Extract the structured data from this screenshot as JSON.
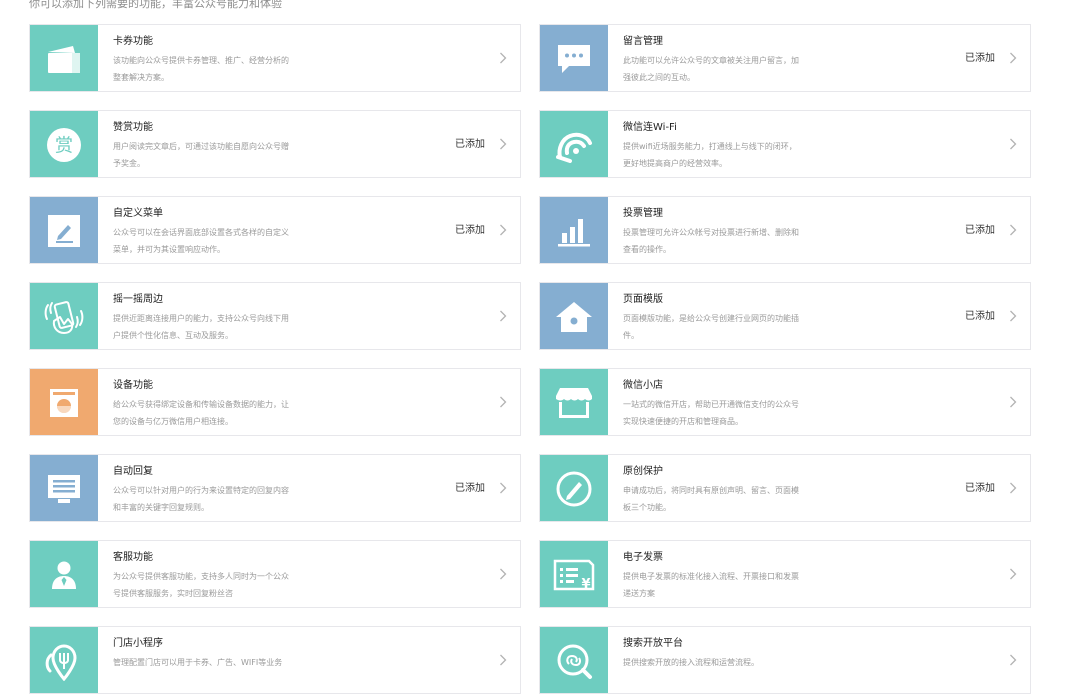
{
  "intro": "你可以添加下列需要的功能，丰富公众号能力和体验",
  "added_label": "已添加",
  "colors": {
    "teal": "#6ecdc0",
    "blue": "#85aed1",
    "orange": "#f0a96f",
    "border": "#e7e7eb"
  },
  "features": [
    {
      "title": "卡券功能",
      "desc": "该功能向公众号提供卡券管理、推广、经营分析的整套解决方案。",
      "status": "",
      "icon": "card-icon"
    },
    {
      "title": "留言管理",
      "desc": "此功能可以允许公众号的文章被关注用户留言，加强彼此之间的互动。",
      "status": "已添加",
      "icon": "message-icon"
    },
    {
      "title": "赞赏功能",
      "desc": "用户阅读完文章后，可通过该功能自愿向公众号赠予奖金。",
      "status": "已添加",
      "icon": "reward-icon"
    },
    {
      "title": "微信连Wi-Fi",
      "desc": "提供wifi近场服务能力，打通线上与线下的闭环，更好地提高商户的经营效率。",
      "status": "",
      "icon": "wifi-icon"
    },
    {
      "title": "自定义菜单",
      "desc": "公众号可以在会话界面底部设置各式各样的自定义菜单，并可为其设置响应动作。",
      "status": "已添加",
      "icon": "edit-menu-icon"
    },
    {
      "title": "投票管理",
      "desc": "投票管理可允许公众帐号对投票进行新增、删除和查看的操作。",
      "status": "已添加",
      "icon": "bar-chart-icon"
    },
    {
      "title": "摇一摇周边",
      "desc": "提供近距离连接用户的能力，支持公众号向线下用户提供个性化信息、互动及服务。",
      "status": "",
      "icon": "shake-phone-icon"
    },
    {
      "title": "页面模版",
      "desc": "页面模版功能，是给公众号创建行业网页的功能插件。",
      "status": "已添加",
      "icon": "house-icon"
    },
    {
      "title": "设备功能",
      "desc": "给公众号获得绑定设备和传输设备数据的能力，让您的设备与亿万微信用户相连接。",
      "status": "",
      "icon": "device-icon"
    },
    {
      "title": "微信小店",
      "desc": "一站式的微信开店，帮助已开通微信支付的公众号实现快速便捷的开店和管理商品。",
      "status": "",
      "icon": "store-icon"
    },
    {
      "title": "自动回复",
      "desc": "公众号可以针对用户的行为来设置特定的回复内容和丰富的关键字回复规则。",
      "status": "已添加",
      "icon": "auto-reply-icon"
    },
    {
      "title": "原创保护",
      "desc": "申请成功后，将同时具有原创声明、留言、页面模板三个功能。",
      "status": "已添加",
      "icon": "original-pen-icon"
    },
    {
      "title": "客服功能",
      "desc": "为公众号提供客服功能，支持多人同时为一个公众号提供客服服务，实时回复粉丝咨",
      "status": "",
      "icon": "customer-service-icon"
    },
    {
      "title": "电子发票",
      "desc": "提供电子发票的标准化接入流程、开票接口和发票递送方案",
      "status": "",
      "icon": "invoice-icon"
    },
    {
      "title": "门店小程序",
      "desc": "管理配置门店可以用于卡券、广告、WIFI等业务",
      "status": "",
      "icon": "store-location-icon"
    },
    {
      "title": "搜索开放平台",
      "desc": "提供搜索开放的接入流程和运营流程。",
      "status": "",
      "icon": "search-platform-icon"
    }
  ]
}
